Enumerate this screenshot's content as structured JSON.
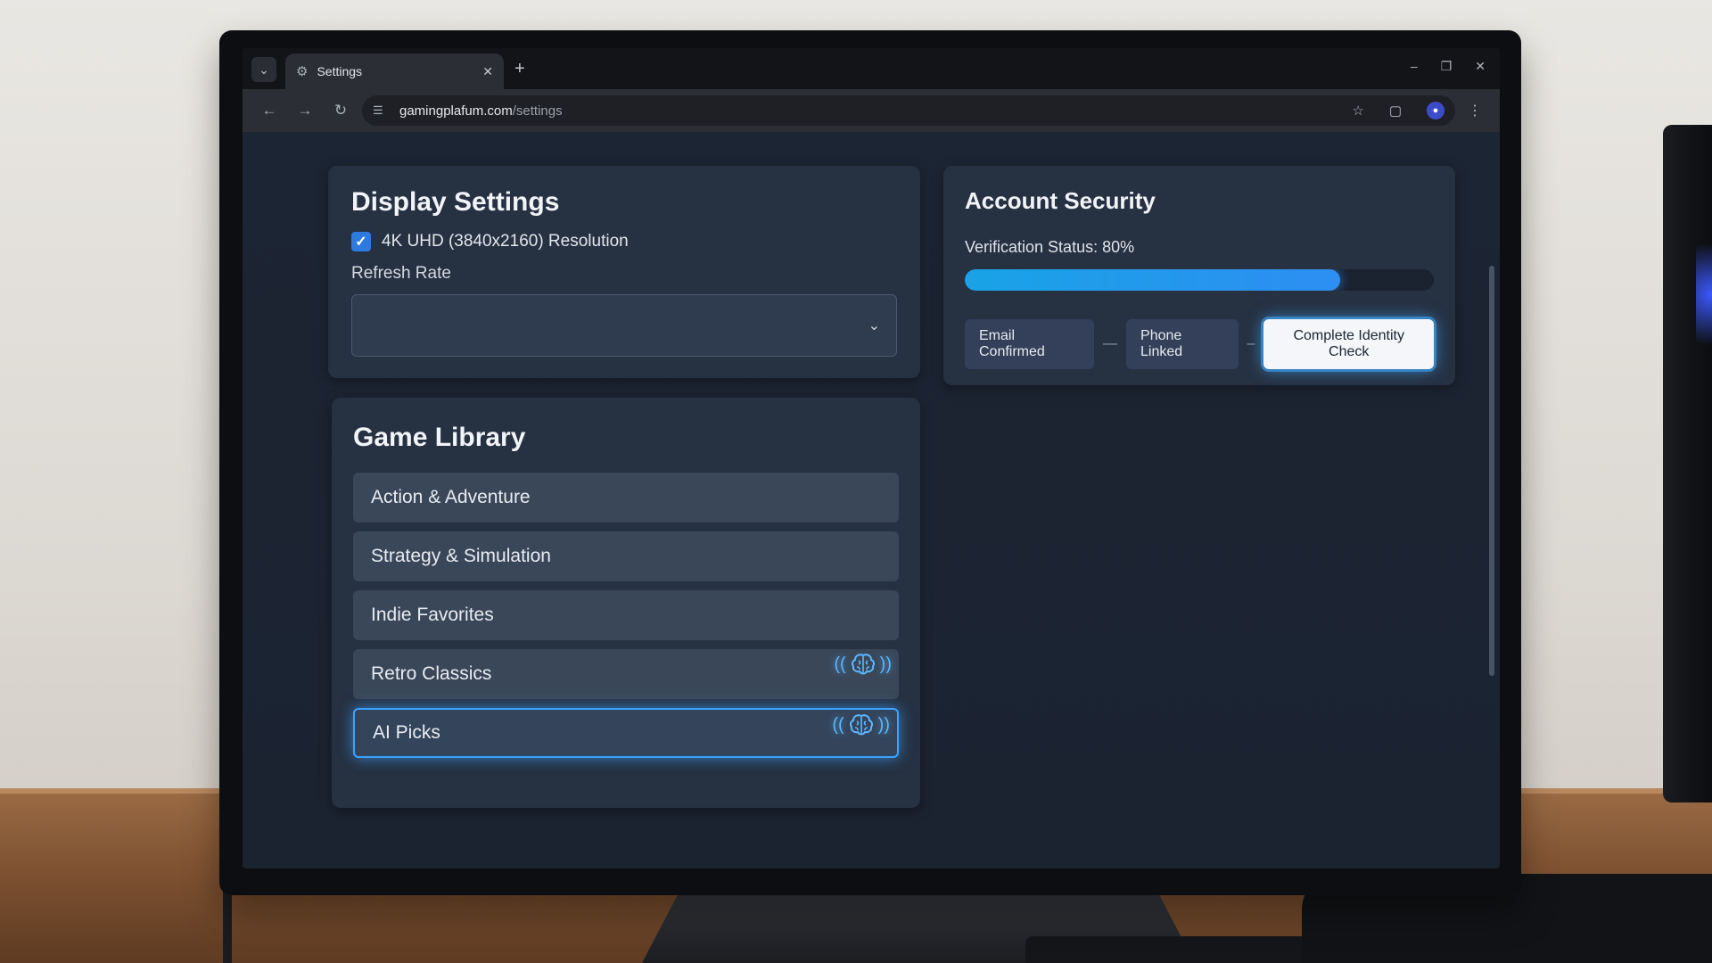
{
  "browser": {
    "tab_title": "Settings",
    "url_host": "gamingplafum.com",
    "url_path": "/settings"
  },
  "display_settings": {
    "title": "Display Settings",
    "resolution_label": "4K UHD (3840x2160) Resolution",
    "resolution_checked": true,
    "refresh_rate_label": "Refresh Rate",
    "refresh_rate_value": ""
  },
  "account_security": {
    "title": "Account Security",
    "status_label": "Verification Status: 80%",
    "progress_percent": 80,
    "steps": [
      {
        "label": "Email Confirmed"
      },
      {
        "label": "Phone Linked"
      }
    ],
    "cta_label": "Complete Identity Check"
  },
  "game_library": {
    "title": "Game Library",
    "items": [
      {
        "label": "Action & Adventure"
      },
      {
        "label": "Strategy & Simulation"
      },
      {
        "label": "Indie Favorites"
      },
      {
        "label": "Retro Classics"
      },
      {
        "label": "AI Picks"
      }
    ]
  },
  "colors": {
    "accent": "#2d8ef2",
    "glow": "#3aa3ff"
  },
  "icons": {
    "tab": "gear-icon",
    "ai_badge": "brain-icon"
  }
}
